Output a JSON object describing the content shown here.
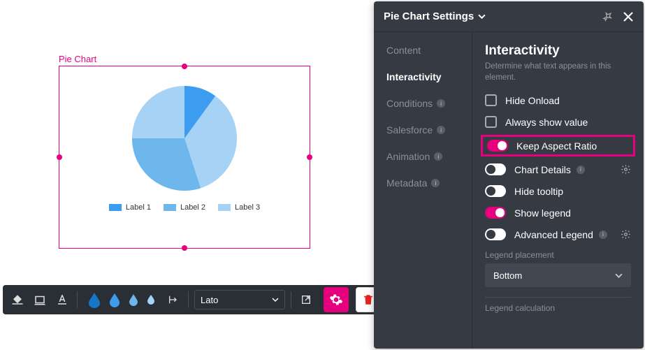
{
  "canvas": {
    "element_label": "Pie Chart"
  },
  "chart_data": {
    "type": "pie",
    "series": [
      {
        "name": "Label 1",
        "value": 15,
        "color": "#3b9cf0"
      },
      {
        "name": "Label 2",
        "value": 30,
        "color": "#6eb7ec"
      },
      {
        "name": "Label 3",
        "value": 55,
        "color": "#a6d3f5"
      }
    ],
    "legend_position": "Bottom"
  },
  "toolbar": {
    "font": "Lato",
    "drop_colors": [
      "#1676c8",
      "#3b9cf0",
      "#6eb7ec",
      "#a6d3f5"
    ]
  },
  "panel": {
    "title": "Pie Chart Settings",
    "tabs": {
      "content": "Content",
      "interactivity": "Interactivity",
      "conditions": "Conditions",
      "salesforce": "Salesforce",
      "animation": "Animation",
      "metadata": "Metadata"
    },
    "section": {
      "title": "Interactivity",
      "subtitle": "Determine what text appears in this element.",
      "hide_onload": "Hide Onload",
      "always_show_value": "Always show value",
      "keep_aspect_ratio": "Keep Aspect Ratio",
      "chart_details": "Chart Details",
      "hide_tooltip": "Hide tooltip",
      "show_legend": "Show legend",
      "advanced_legend": "Advanced Legend",
      "legend_placement_label": "Legend placement",
      "legend_placement_value": "Bottom",
      "legend_calculation_label": "Legend calculation"
    }
  }
}
